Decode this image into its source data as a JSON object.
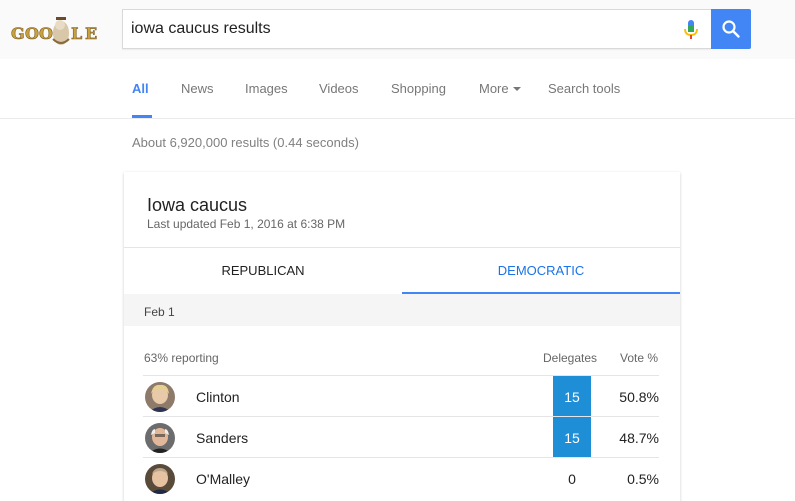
{
  "search": {
    "query": "iowa caucus results"
  },
  "logo": {
    "text": "GOOGLE"
  },
  "tabs": [
    {
      "label": "All"
    },
    {
      "label": "News"
    },
    {
      "label": "Images"
    },
    {
      "label": "Videos"
    },
    {
      "label": "Shopping"
    },
    {
      "label": "More"
    },
    {
      "label": "Search tools"
    }
  ],
  "stats": "About 6,920,000 results (0.44 seconds)",
  "card": {
    "title": "Iowa caucus",
    "updated": "Last updated Feb 1, 2016 at 6:38 PM",
    "party_tabs": {
      "republican": "REPUBLICAN",
      "democratic": "DEMOCRATIC"
    },
    "date": "Feb 1",
    "reporting": "63% reporting",
    "col_delegates": "Delegates",
    "col_vote": "Vote %",
    "candidates": [
      {
        "name": "Clinton",
        "delegates": "15",
        "vote": "50.8%",
        "leading": true
      },
      {
        "name": "Sanders",
        "delegates": "15",
        "vote": "48.7%",
        "leading": true
      },
      {
        "name": "O'Malley",
        "delegates": "0",
        "vote": "0.5%",
        "leading": false
      }
    ]
  },
  "colors": {
    "accent": "#4285f4",
    "delegate_highlight": "#1e8fd6"
  },
  "icons": [
    "microphone-icon",
    "search-icon",
    "chevron-down-icon"
  ]
}
